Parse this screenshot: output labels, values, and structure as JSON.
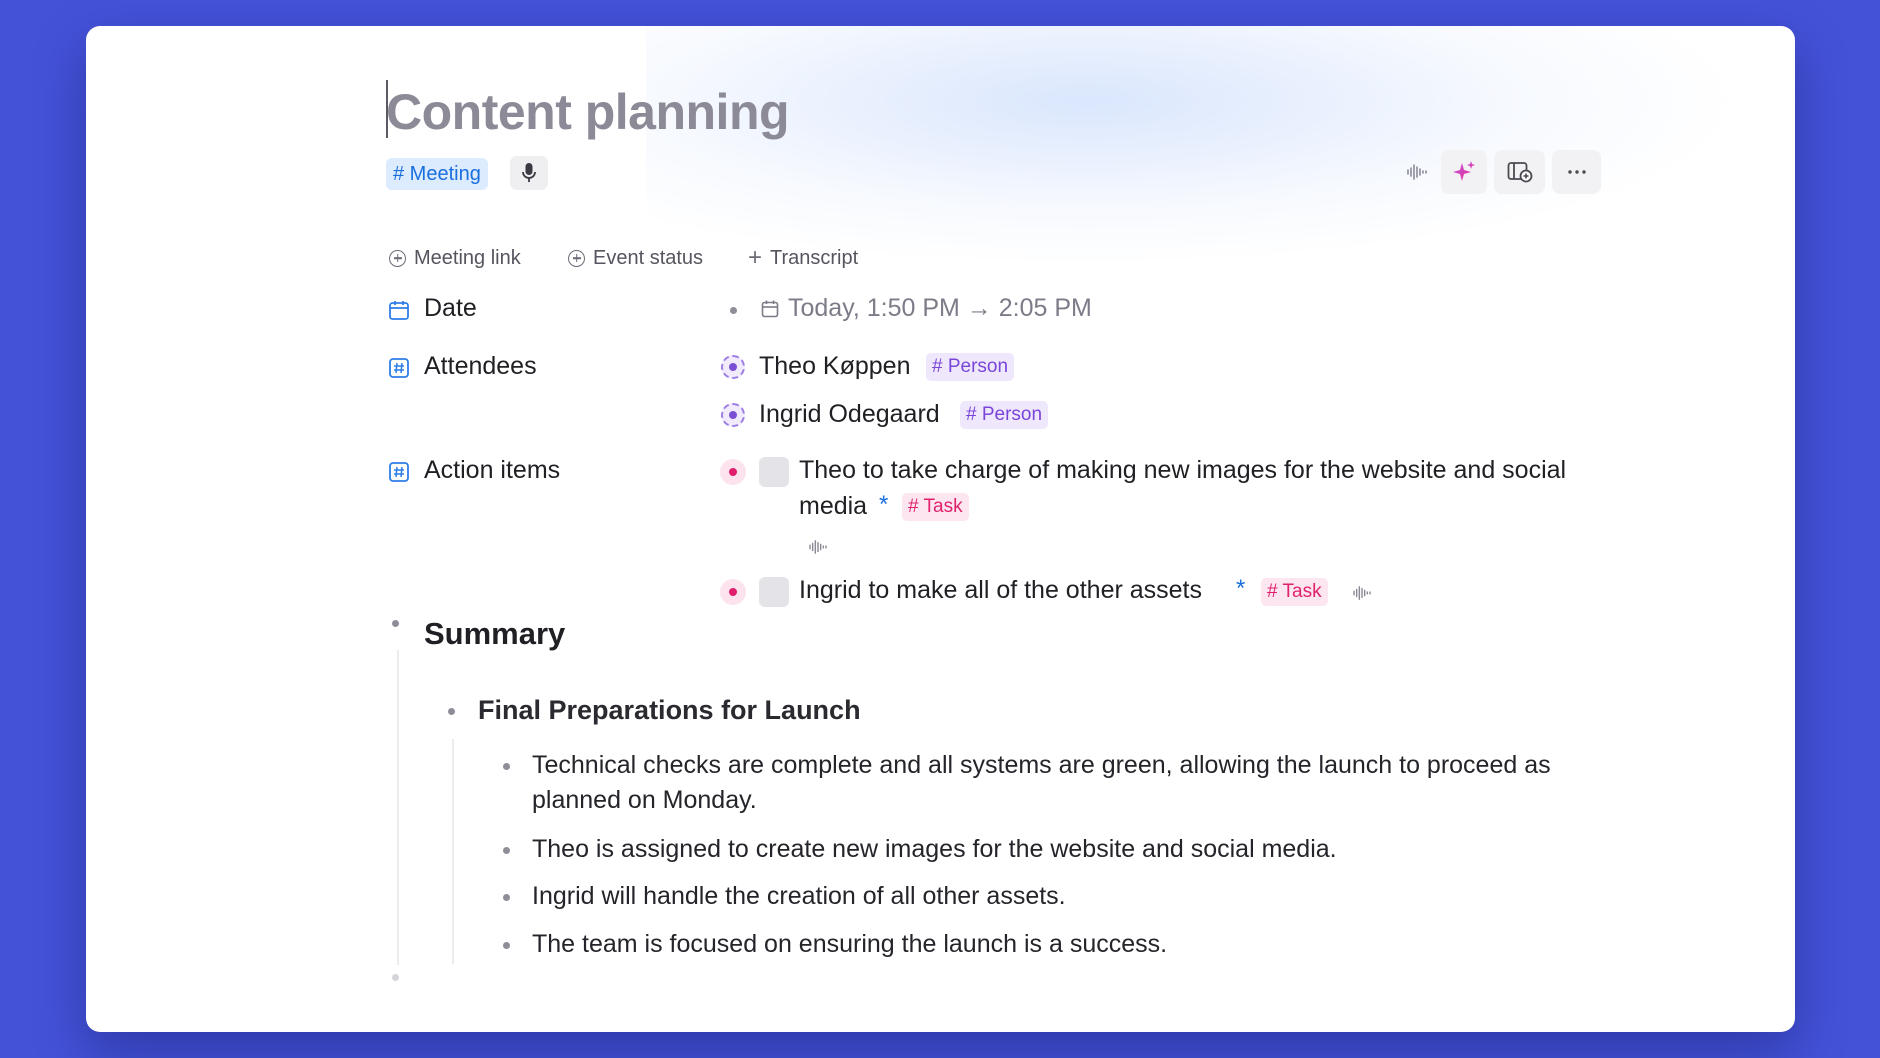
{
  "document": {
    "title": "Content planning",
    "tag": "# Meeting"
  },
  "add_properties": {
    "meeting_link": "Meeting link",
    "event_status": "Event status",
    "transcript": "Transcript"
  },
  "fields": {
    "date": {
      "label": "Date",
      "value": "Today, 1:50 PM → 2:05 PM"
    },
    "attendees": {
      "label": "Attendees",
      "items": [
        {
          "name": "Theo Køppen",
          "tag": "# Person"
        },
        {
          "name": "Ingrid Odegaard",
          "tag": "# Person"
        }
      ]
    },
    "action_items": {
      "label": "Action items",
      "items": [
        {
          "line1": "Theo to take charge of making new images for the website and social",
          "line2": "media",
          "star": "*",
          "tag": "# Task",
          "checked": false
        },
        {
          "line1": "Ingrid to make all of the other assets",
          "star": "*",
          "tag": "# Task",
          "checked": false
        }
      ]
    }
  },
  "summary": {
    "heading": "Summary",
    "section": {
      "heading": "Final Preparations for Launch",
      "points": [
        {
          "line1": "Technical checks are complete and all systems are green, allowing the launch to proceed as",
          "line2": "planned on Monday."
        },
        {
          "line1": "Theo is assigned to create new images for the website and social media."
        },
        {
          "line1": "Ingrid will handle the creation of all other assets."
        },
        {
          "line1": "The team is focused on ensuring the launch is a success."
        }
      ]
    }
  },
  "icons": {
    "mic": "microphone-icon",
    "audio": "audio-wave-icon",
    "ai": "sparkle-icon",
    "panel": "panel-info-icon",
    "more": "more-horizontal-icon",
    "calendar": "calendar-icon",
    "hash": "hash-field-icon"
  },
  "colors": {
    "background": "#4452D8",
    "meeting_tag": "#1a6fe0",
    "person_tag": "#7a45d9",
    "task_tag": "#e0226e"
  }
}
